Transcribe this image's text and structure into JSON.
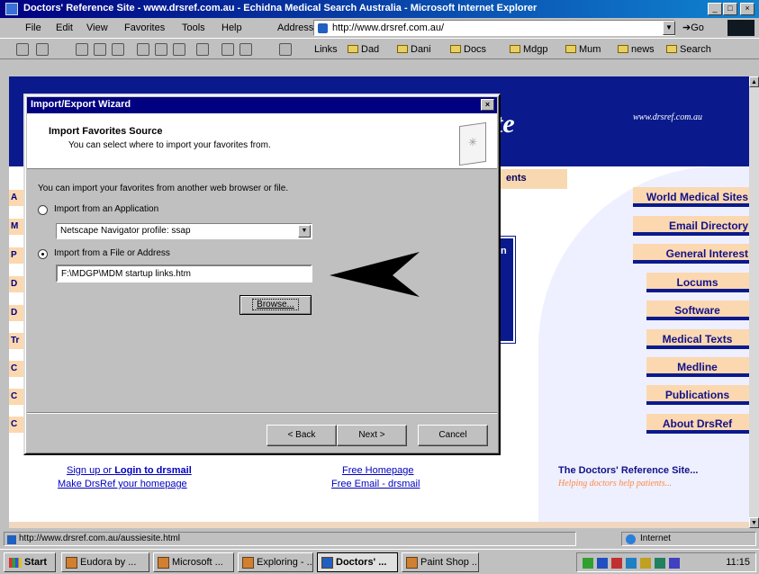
{
  "window": {
    "title": "Doctors' Reference Site - www.drsref.com.au - Echidna Medical Search Australia - Microsoft Internet Explorer",
    "controls": [
      "_",
      "□",
      "×"
    ]
  },
  "menu": [
    "File",
    "Edit",
    "View",
    "Favorites",
    "Tools",
    "Help"
  ],
  "address": {
    "label": "Address",
    "value": "http://www.drsref.com.au/",
    "go_label": "Go"
  },
  "links_bar": {
    "label": "Links",
    "items": [
      "Dad",
      "Dani",
      "Docs",
      "Mdgp",
      "Mum",
      "news",
      "Search"
    ]
  },
  "page": {
    "title_fragment": "te",
    "site_url": "www.drsref.com.au",
    "tab_fragment": "ents",
    "left_stubs": [
      "A",
      "M",
      "P",
      "D",
      "D",
      "Tr",
      "C",
      "C",
      "C"
    ],
    "blue_box_label": "n",
    "nav": [
      "World Medical Sites",
      "Email Directory",
      "General Interest",
      "Locums",
      "Software",
      "Medical Texts",
      "Medline",
      "Publications",
      "About DrsRef"
    ],
    "links": {
      "signup_pre": "Sign up or ",
      "signup_bold": "Login to drsmail",
      "homepage": "Make DrsRef your homepage",
      "free_homepage": "Free Homepage",
      "free_email": "Free Email - drsmail"
    },
    "footer_brand": "The Doctors' Reference Site...",
    "footer_tagline": "Helping doctors help patients..."
  },
  "dialog": {
    "title": "Import/Export Wizard",
    "heading": "Import Favorites Source",
    "subheading": "You can select where to import your favorites from.",
    "intro": "You can import your favorites from another web browser or file.",
    "option_app": "Import from an Application",
    "app_select_value": "Netscape Navigator profile: ssap",
    "option_file": "Import from a File or Address",
    "file_value": "F:\\MDGP\\MDM startup links.htm",
    "browse_label": "Browse...",
    "back_label": "< Back",
    "next_label": "Next >",
    "cancel_label": "Cancel",
    "selected_option": "file"
  },
  "status_bar": {
    "text": "http://www.drsref.com.au/aussiesite.html",
    "zone": "Internet"
  },
  "taskbar": {
    "start": "Start",
    "tasks": [
      "Eudora by ...",
      "Microsoft ...",
      "Exploring - ...",
      "Doctors' ...",
      "Paint Shop ..."
    ],
    "active_task_index": 3,
    "clock": "11:15"
  },
  "colors": {
    "site_blue": "#0a1a8c",
    "nav_peach": "#fbd8b0",
    "titlebar": "#000080"
  }
}
